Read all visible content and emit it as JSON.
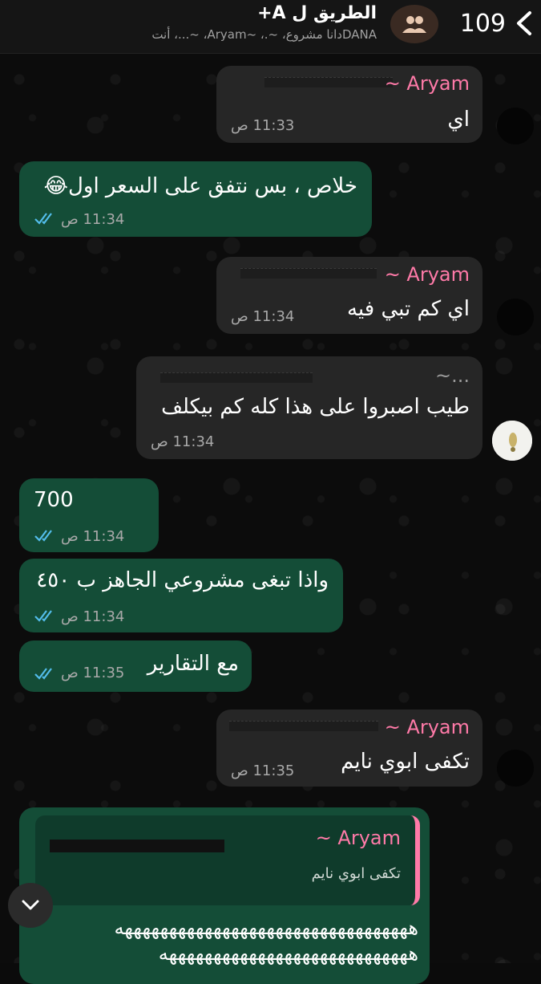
{
  "header": {
    "back_count": "109",
    "title": "الطريق ل A+",
    "subtitle": "DANAدانا  مشروع، ~.، ~Aryam، ~...، أنت"
  },
  "messages": [
    {
      "sender": "~ Aryam",
      "text": "اي",
      "time": "11:33 ص"
    },
    {
      "text": "خلاص ، بس نتفق على السعر اول",
      "emoji": "😂",
      "time": "11:34 ص"
    },
    {
      "sender": "~ Aryam",
      "text": "اي كم تبي فيه",
      "time": "11:34 ص"
    },
    {
      "sender": "~...",
      "text": "طيب اصبروا على هذا كله كم بيكلف",
      "time": "11:34 ص"
    },
    {
      "text": "700",
      "time": "11:34 ص"
    },
    {
      "text": "واذا تبغى مشروعي الجاهز ب ٤٥٠",
      "time": "11:34 ص"
    },
    {
      "text": "مع التقارير",
      "time": "11:35 ص"
    },
    {
      "sender": "~ Aryam",
      "text": "تكفى ابوي نايم",
      "time": "11:35 ص"
    }
  ],
  "reply_message": {
    "quoted_sender": "~ Aryam",
    "quoted_text": "تكفى ابوي نايم",
    "line1": "هههههههههههههههههههههههههههههههههه",
    "line2": "ههههههههههههههههههههههههههههه"
  },
  "colors": {
    "incoming": "#262626",
    "outgoing": "#144d37",
    "sender": "#ff7aa8",
    "read_ticks": "#53bdeb"
  },
  "icons": [
    "chevron-left-icon",
    "group-icon",
    "double-check-icon",
    "chevron-down-icon"
  ]
}
